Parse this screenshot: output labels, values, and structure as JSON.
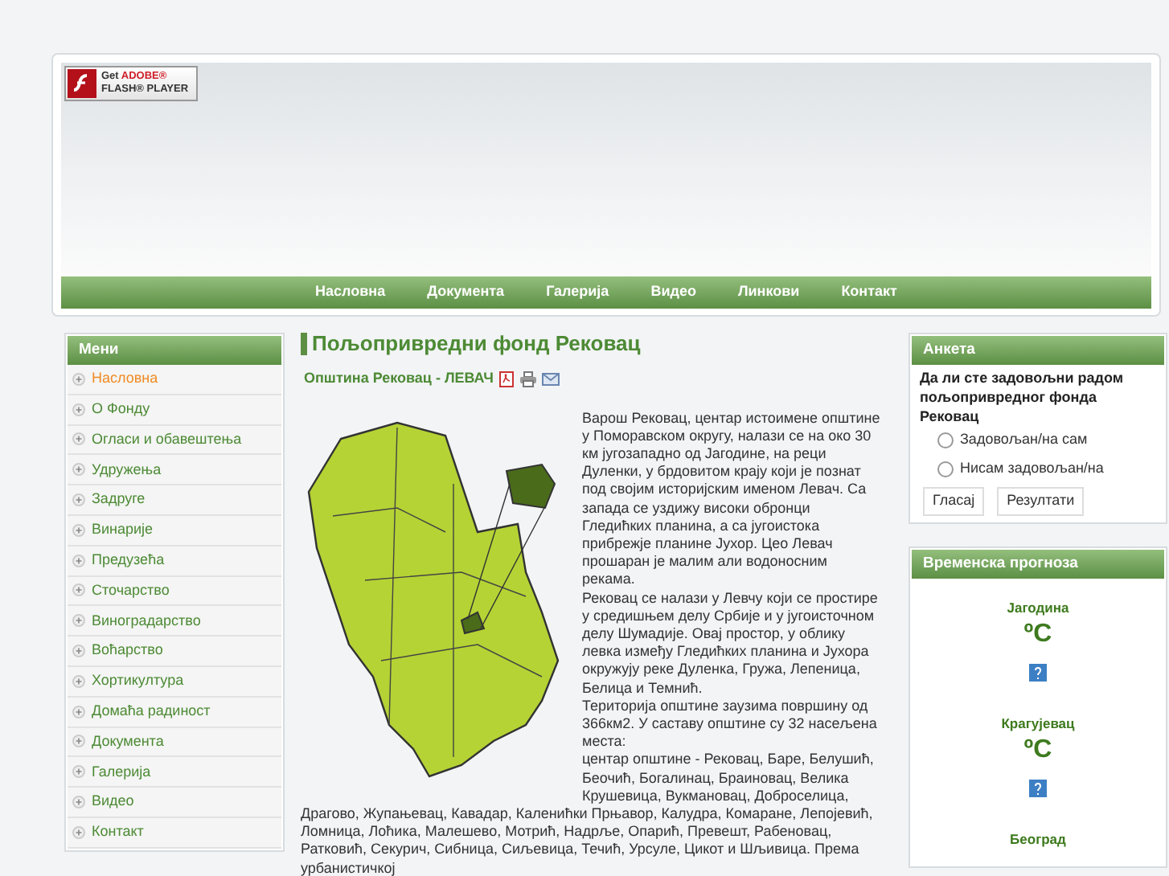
{
  "flash_badge": {
    "line_1": "Get",
    "brand": "ADOBE®",
    "line_2": "FLASH® PLAYER"
  },
  "nav": [
    {
      "label": "Насловна"
    },
    {
      "label": "Документа"
    },
    {
      "label": "Галерија"
    },
    {
      "label": "Видео"
    },
    {
      "label": "Линкови"
    },
    {
      "label": "Контакт"
    }
  ],
  "menu": {
    "title": "Мени",
    "items": [
      {
        "label": "Насловна",
        "selected": true
      },
      {
        "label": "О Фонду",
        "selected": false
      },
      {
        "label": "Огласи и обавештења",
        "selected": false
      },
      {
        "label": "Удружења",
        "selected": false
      },
      {
        "label": "Задруге",
        "selected": false
      },
      {
        "label": "Винарије",
        "selected": false
      },
      {
        "label": "Предузећа",
        "selected": false
      },
      {
        "label": "Сточарство",
        "selected": false
      },
      {
        "label": "Виноградарство",
        "selected": false
      },
      {
        "label": "Воћарство",
        "selected": false
      },
      {
        "label": "Хортикултура",
        "selected": false
      },
      {
        "label": "Домаћа радиност",
        "selected": false
      },
      {
        "label": "Документа",
        "selected": false
      },
      {
        "label": "Галерија",
        "selected": false
      },
      {
        "label": "Видео",
        "selected": false
      },
      {
        "label": "Контакт",
        "selected": false
      }
    ]
  },
  "article": {
    "title": "Пољопривредни фонд Рековац",
    "subtitle": "Општина Рековац - ЛЕВАЧ",
    "paragraphs": [
      "Варош Рековац, центар истоимене општине у Поморавском округу, налази се на око 30 км југозападно од Јагодине, на реци Дуленки, у брдовитом крају који је познат под својим историјским именом Левач. Са запада се уздижу високи обронци Гледићких планина, а са југоистока прибрежје планине Јухор. Цео Левач прошаран је малим али водоносним рекама.",
      "Рековац се налази у Левчу који се простире у средишњем делу Србије и у југоисточном делу Шумадије. Овај простор, у облику левка између Гледићких планина и Јухора окружују реке Дуленка, Гружа, Лепеница, Белица и Темнић.",
      "Територија општине заузима површину од 366км2. У саставу општине су 32 насељена места:",
      "центар општине - Рековац, Баре, Белушић, Беочић, Богалинац, Браиновац, Велика Крушевица, Вукмановац, Доброселица, Драгово, Жупањевац, Кавадар, Каленићки Прњавор, Калудра, Комаране, Лепојевић, Ломница, Лоћика, Малешево, Мотрић, Надрље, Опарић, Превешт, Рабеновац, Ратковић, Секурич, Сибница, Сиљевица, Течић, Урсуле, Цикот и Шљивица. Према урбанистичкој"
    ]
  },
  "poll": {
    "title": "Анкета",
    "question": "Да ли сте задовољни радом пољопривредног фонда Рековац",
    "options": [
      {
        "label": "Задовољан/на сам",
        "selected": false
      },
      {
        "label": "Нисам задовољан/на",
        "selected": false
      }
    ],
    "buttons": [
      "Гласај",
      "Резултати"
    ]
  },
  "weather": {
    "title": "Временска прогноза",
    "cities": [
      {
        "name": "Јагодина",
        "temp": "ºC"
      },
      {
        "name": "Крагујевац",
        "temp": "ºC"
      },
      {
        "name": "Београд"
      }
    ]
  }
}
